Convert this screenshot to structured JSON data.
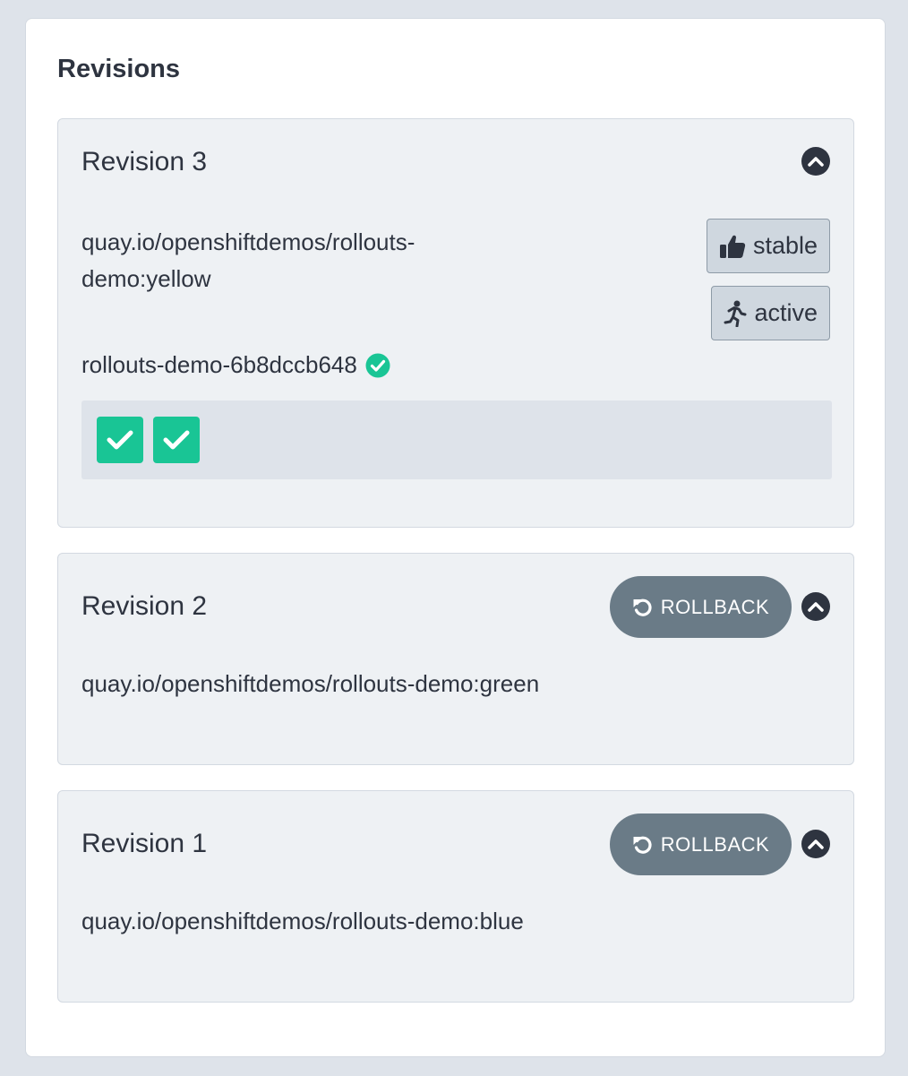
{
  "panel": {
    "title": "Revisions"
  },
  "revisions": [
    {
      "title": "Revision 3",
      "image": "quay.io/openshiftdemos/rollouts-demo:yellow",
      "image_line1": "quay.io/openshiftdemos/rollouts-",
      "image_line2": "demo:yellow",
      "tags": [
        {
          "label": "stable",
          "icon": "thumbs-up-icon"
        },
        {
          "label": "active",
          "icon": "running-icon"
        }
      ],
      "replicaset": "rollouts-demo-6b8dccb648",
      "replicaset_status_icon": "check-circle-icon",
      "pods": [
        {
          "status": "healthy",
          "icon": "check-icon"
        },
        {
          "status": "healthy",
          "icon": "check-icon"
        }
      ],
      "expanded": true
    },
    {
      "title": "Revision 2",
      "rollback_label": "ROLLBACK",
      "image": "quay.io/openshiftdemos/rollouts-demo:green"
    },
    {
      "title": "Revision 1",
      "rollback_label": "ROLLBACK",
      "image": "quay.io/openshiftdemos/rollouts-demo:blue"
    }
  ],
  "colors": {
    "background": "#dee3ea",
    "card": "#eef1f4",
    "text": "#2e3440",
    "rollback_button": "#6a7b87",
    "healthy": "#19c595"
  }
}
